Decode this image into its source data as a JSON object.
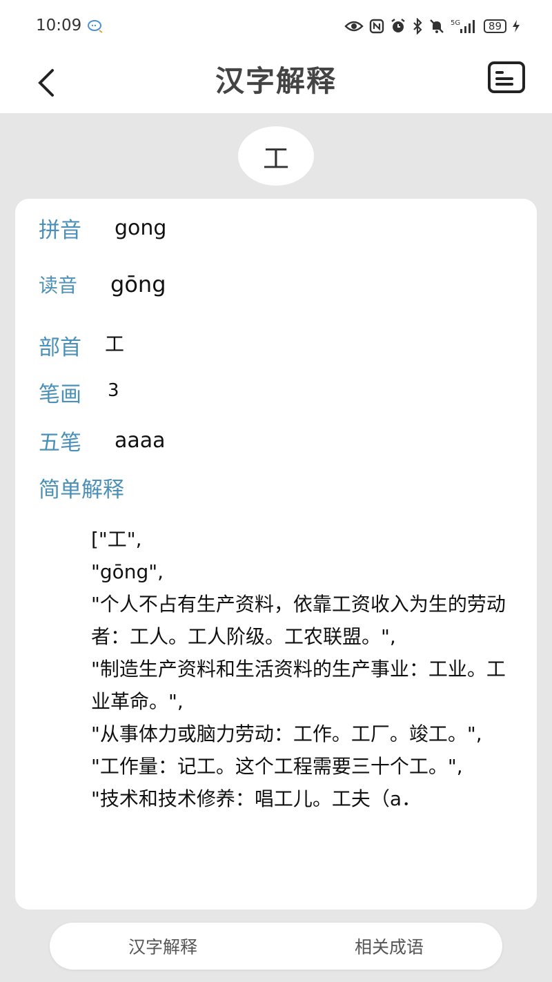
{
  "status_bar": {
    "time": "10:09",
    "network": "5G",
    "battery": "89",
    "icons": [
      "chat-bubble-icon",
      "eye-icon",
      "nfc-icon",
      "alarm-icon",
      "bluetooth-icon",
      "mute-icon",
      "signal-icon",
      "battery-icon",
      "charging-icon"
    ]
  },
  "header": {
    "title": "汉字解释",
    "back_icon": "chevron-left-icon",
    "menu_icon": "note-card-icon"
  },
  "character": "工",
  "details": {
    "pinyin_label": "拼音",
    "pinyin_value": "gong",
    "reading_label": "读音",
    "reading_value": "gōng",
    "radical_label": "部首",
    "radical_value": "工",
    "strokes_label": "笔画",
    "strokes_value": "3",
    "wubi_label": "五笔",
    "wubi_value": "aaaa",
    "explanation_label": "简单解释",
    "explanation_text": "[\"工\",\n\"gōng\",\n\"个人不占有生产资料，依靠工资收入为生的劳动者：工人。工人阶级。工农联盟。\",\n\"制造生产资料和生活资料的生产事业：工业。工业革命。\",\n\"从事体力或脑力劳动：工作。工厂。竣工。\",\n\"工作量：记工。这个工程需要三十个工。\",\n\"技术和技术修养：唱工儿。工夫（a．"
  },
  "tabs": [
    {
      "label": "汉字解释"
    },
    {
      "label": "相关成语"
    }
  ],
  "colors": {
    "accent_label": "#4a90b8",
    "background": "#e6e6e6",
    "card": "#ffffff"
  }
}
